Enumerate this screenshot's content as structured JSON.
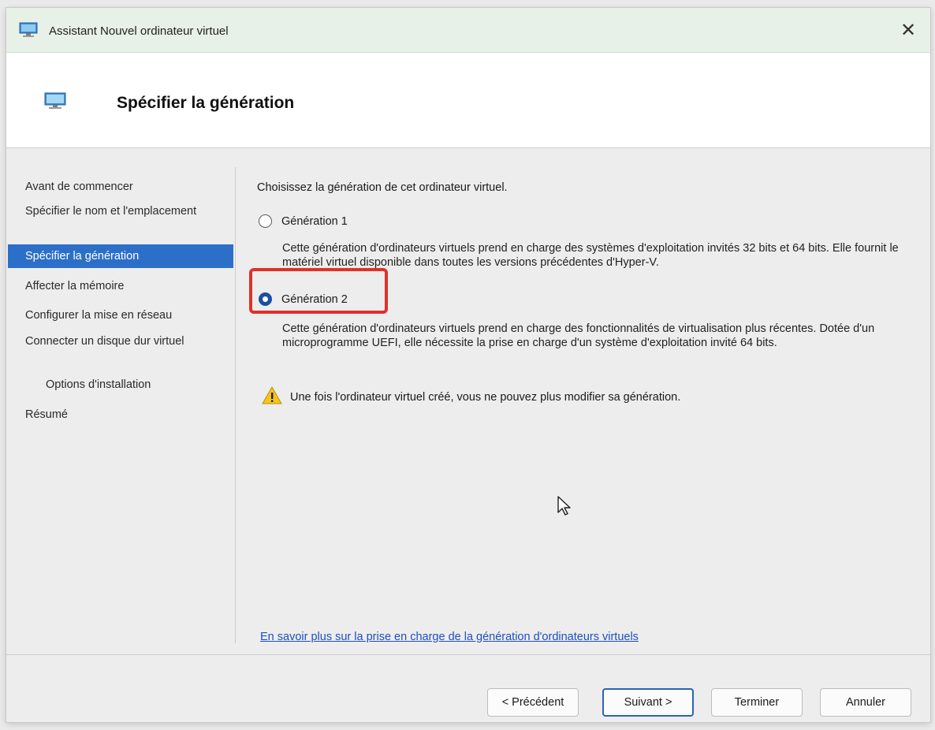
{
  "window": {
    "title": "Assistant Nouvel ordinateur virtuel",
    "close_glyph": "✕"
  },
  "header": {
    "title": "Spécifier la génération"
  },
  "nav": {
    "items": [
      {
        "label": "Avant de commencer"
      },
      {
        "label": "Spécifier le nom et l'emplacement"
      },
      {
        "label": "Spécifier la génération",
        "active": true
      },
      {
        "label": "Affecter la mémoire"
      },
      {
        "label": "Configurer la mise en réseau"
      },
      {
        "label": "Connecter un disque dur virtuel"
      },
      {
        "label": "Options d'installation",
        "sub": true
      },
      {
        "label": "Résumé"
      }
    ]
  },
  "content": {
    "intro": "Choisissez la génération de cet ordinateur virtuel.",
    "gen1": {
      "label": "Génération 1",
      "checked": false,
      "description": "Cette génération d'ordinateurs virtuels prend en charge des systèmes d'exploitation invités 32 bits et 64 bits. Elle fournit le matériel virtuel disponible dans toutes les versions précédentes d'Hyper-V."
    },
    "gen2": {
      "label": "Génération 2",
      "checked": true,
      "description": "Cette génération d'ordinateurs virtuels prend en charge des fonctionnalités de virtualisation plus récentes. Dotée d'un microprogramme UEFI, elle nécessite la prise en charge d'un système d'exploitation invité 64 bits."
    },
    "warning": "Une fois l'ordinateur virtuel créé, vous ne pouvez plus modifier sa génération.",
    "link": "En savoir plus sur la prise en charge de la génération d'ordinateurs virtuels"
  },
  "footer": {
    "previous": "< Précédent",
    "next": "Suivant >",
    "finish": "Terminer",
    "cancel": "Annuler"
  },
  "colors": {
    "accent": "#2c6fc9",
    "highlight": "#e0302b",
    "link": "#1d4fbf",
    "titlebar": "#e8f1e7"
  },
  "icons": {
    "app": "monitor-icon",
    "header": "monitor-icon",
    "close": "close-icon",
    "warning": "warning-icon",
    "cursor": "mouse-cursor-icon"
  }
}
